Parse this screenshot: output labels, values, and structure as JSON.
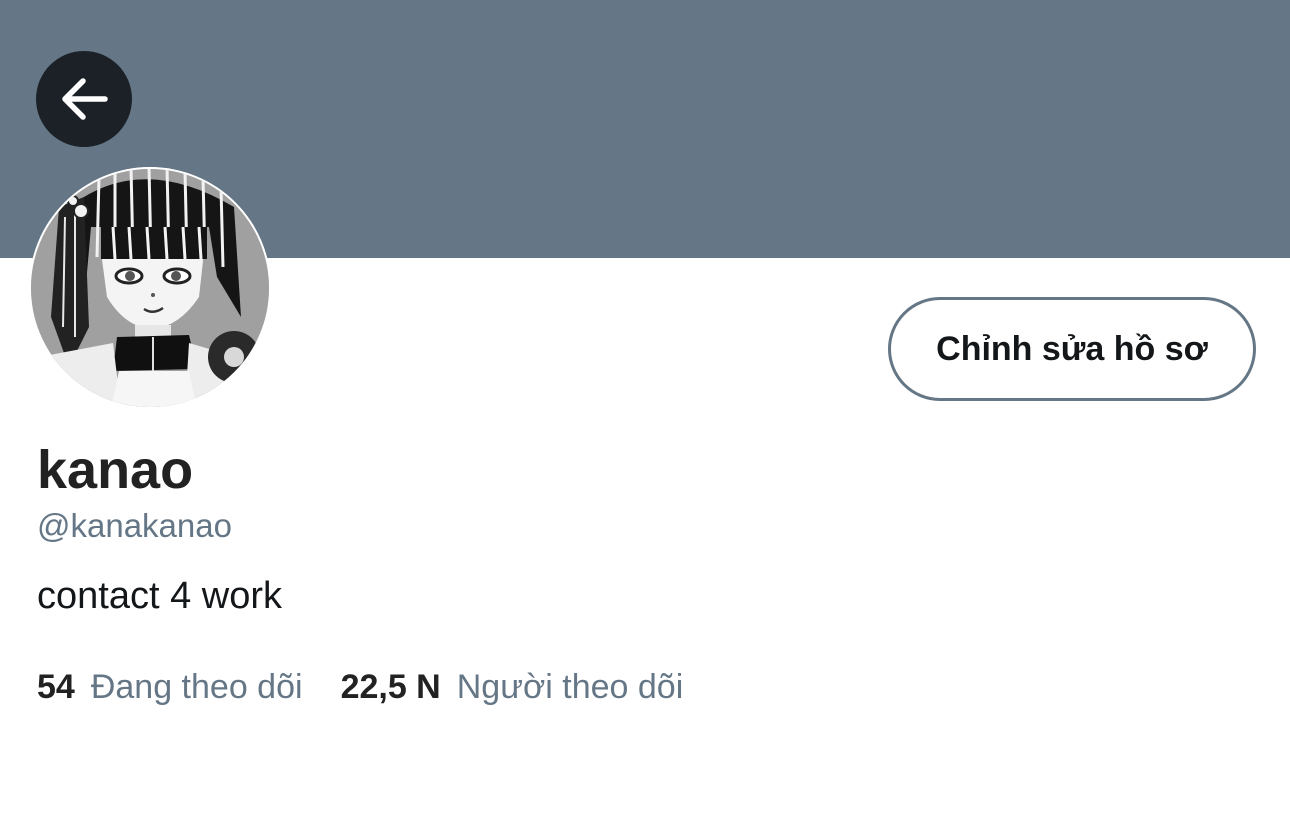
{
  "profile": {
    "display_name": "kanao",
    "handle": "@kanakanao",
    "bio": "contact 4 work",
    "edit_button_label": "Chỉnh sửa hồ sơ"
  },
  "stats": {
    "following_count": "54",
    "following_label": "Đang theo dõi",
    "followers_count": "22,5 N",
    "followers_label": "Người theo dõi"
  },
  "icons": {
    "back": "arrow-left-icon",
    "avatar": "anime-portrait-avatar"
  },
  "colors": {
    "banner": "#657786",
    "back_button": "#1b2126",
    "secondary_text": "#657786",
    "primary_text": "#14171a"
  }
}
